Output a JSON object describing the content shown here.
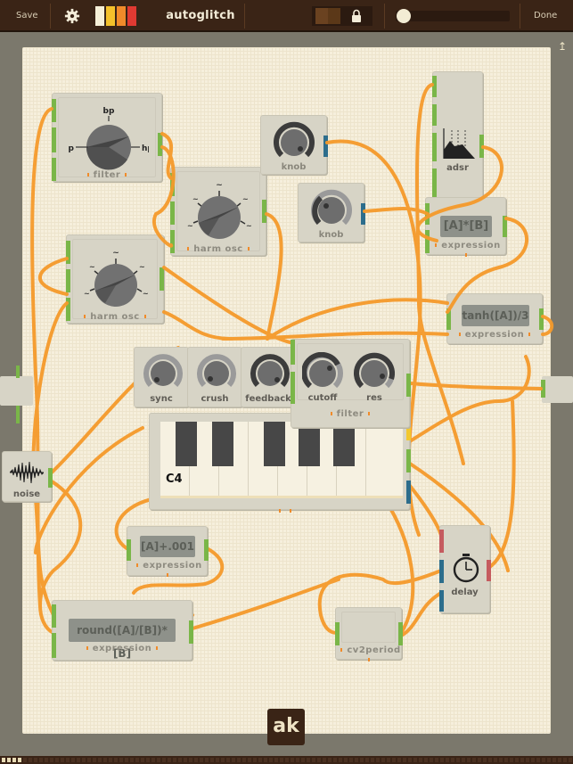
{
  "topbar": {
    "save_label": "Save",
    "settings_icon": "gear-icon",
    "theme_swatches": [
      "#f6f0d8",
      "#f4c12b",
      "#f08b2a",
      "#e03a32"
    ],
    "title": "autoglitch",
    "lock_icon": "lock-icon",
    "done_label": "Done",
    "slider_value": 0.0
  },
  "canvas": {
    "pin_icon": "pin-icon",
    "wire_color": "#f59a2b",
    "modules": {
      "filter1": {
        "label": "filter",
        "knob_labels": {
          "top": "bp",
          "left": "lp",
          "right": "hp"
        }
      },
      "harm_osc1": {
        "label": "harm osc"
      },
      "harm_osc2": {
        "label": "harm osc"
      },
      "knob1": {
        "label": "knob"
      },
      "knob2": {
        "label": "knob"
      },
      "adsr": {
        "label": "adsr"
      },
      "expr_mul": {
        "expression": "[A]*[B]",
        "label": "expression"
      },
      "expr_tanh": {
        "expression": "tanh([A])/3",
        "label": "expression"
      },
      "sync": {
        "label": "sync"
      },
      "crush": {
        "label": "crush"
      },
      "feedback": {
        "label": "feedback"
      },
      "filter2": {
        "label": "filter",
        "cutoff_label": "cutoff",
        "res_label": "res"
      },
      "keyboard": {
        "note_label": "C4"
      },
      "noise": {
        "label": "noise"
      },
      "expr_add": {
        "expression": "[A]+.001",
        "label": "expression"
      },
      "delay": {
        "label": "delay"
      },
      "expr_round": {
        "expression": "round([A]/[B])*[B]",
        "label": "expression"
      },
      "cv2period": {
        "label": "cv2period"
      }
    },
    "logo_label": "ak"
  },
  "bottombar": {
    "page_indicator_active": 4
  }
}
